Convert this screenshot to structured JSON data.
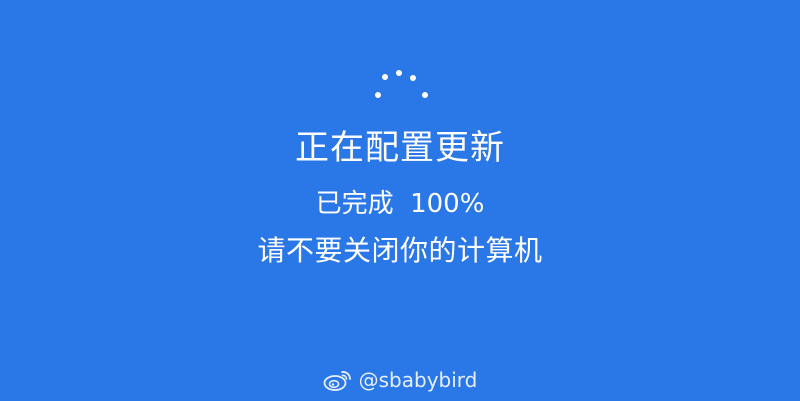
{
  "update_screen": {
    "title": "正在配置更新",
    "progress_text": "已完成  100%",
    "progress_fraction": 1.0,
    "warning": "请不要关闭你的计算机",
    "spinner_icon": "loading-dots-icon"
  },
  "watermark": {
    "icon": "weibo-icon",
    "text": "@sbabybird"
  },
  "colors": {
    "background": "#2a77e8",
    "text": "#ffffff"
  }
}
